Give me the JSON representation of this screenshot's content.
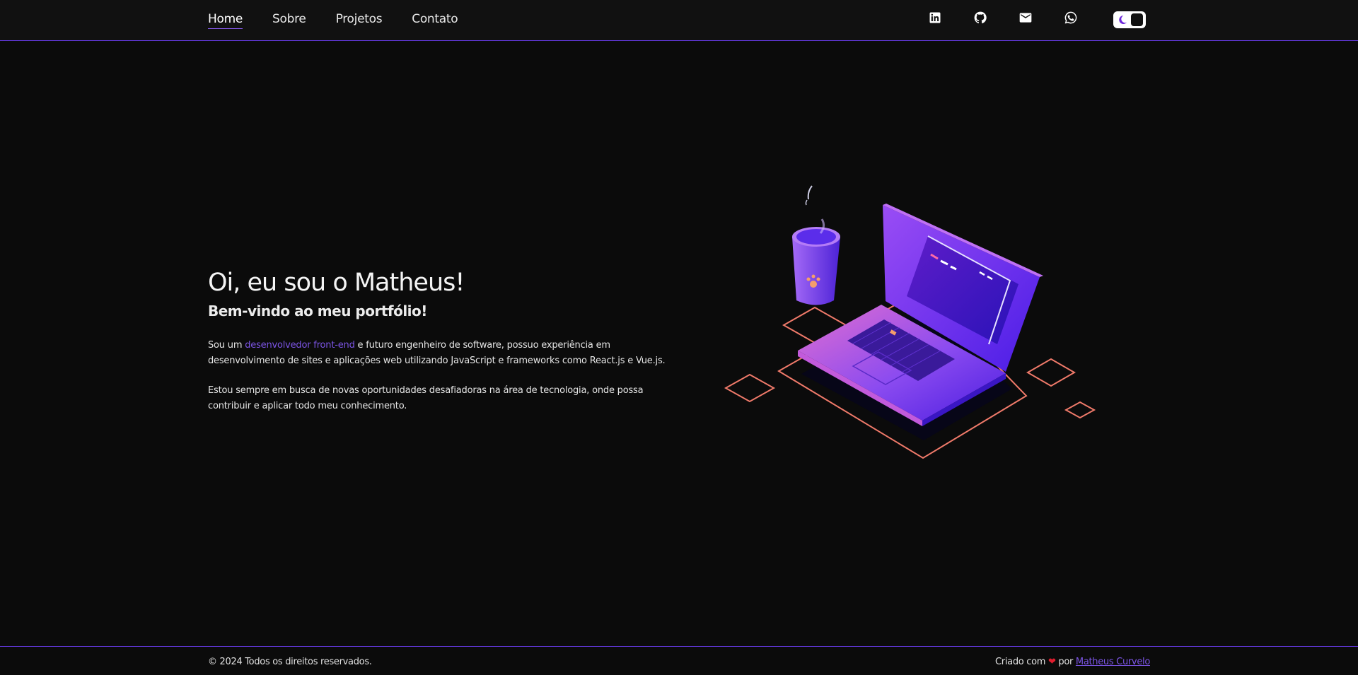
{
  "nav": {
    "items": [
      {
        "label": "Home",
        "active": true
      },
      {
        "label": "Sobre",
        "active": false
      },
      {
        "label": "Projetos",
        "active": false
      },
      {
        "label": "Contato",
        "active": false
      }
    ]
  },
  "socials": [
    "linkedin-icon",
    "github-icon",
    "mail-icon",
    "whatsapp-icon"
  ],
  "theme_toggle": {
    "mode": "dark",
    "icon": "moon-icon"
  },
  "hero": {
    "title": "Oi, eu sou o Matheus!",
    "subtitle": "Bem-vindo ao meu portfólio!",
    "para1_before": "Sou um ",
    "para1_highlight": "desenvolvedor front-end",
    "para1_after": " e futuro engenheiro de software, possuo experiência em desenvolvimento de sites e aplicações web utilizando JavaScript e frameworks como React.js e Vue.js.",
    "para2": "Estou sempre em busca de novas oportunidades desafiadoras na área de tecnologia, onde possa contribuir e aplicar todo meu conhecimento."
  },
  "footer": {
    "copyright": "© 2024 Todos os direitos reservados.",
    "credit_prefix": "Criado com",
    "credit_middle": "por",
    "author": "Matheus Curvelo"
  },
  "colors": {
    "background": "#0b0b0b",
    "accent": "#7c55e6",
    "border": "#6a3cf0",
    "heart": "#e11d2e",
    "outline": "#f07a6a"
  }
}
